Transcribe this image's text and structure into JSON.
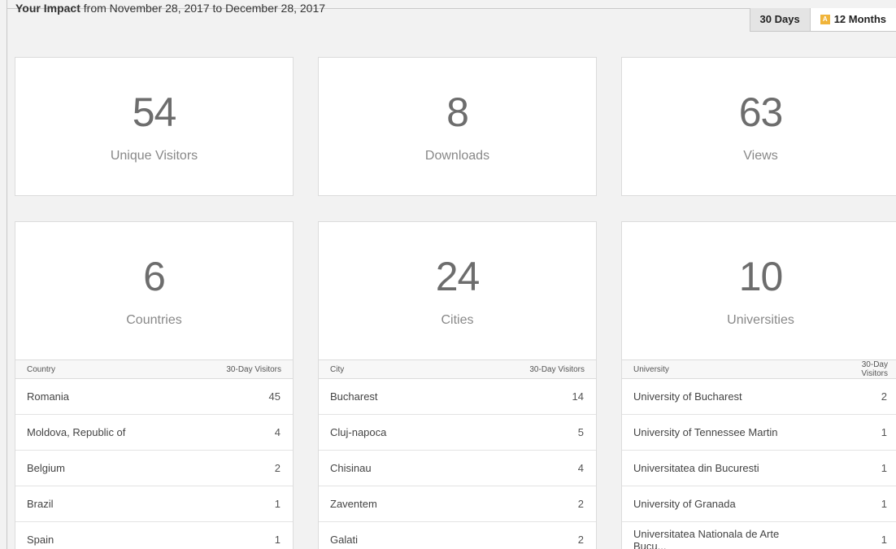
{
  "header": {
    "title_strong": "Your Impact",
    "title_rest": " from November 28, 2017 to December 28, 2017"
  },
  "toggle": {
    "days_label": "30 Days",
    "months_label": "12 Months",
    "months_icon_letter": "A"
  },
  "summary": [
    {
      "value": "54",
      "label": "Unique Visitors"
    },
    {
      "value": "8",
      "label": "Downloads"
    },
    {
      "value": "63",
      "label": "Views"
    }
  ],
  "breakdown": [
    {
      "value": "6",
      "label": "Countries",
      "col_name": "Country",
      "col_value": "30-Day Visitors",
      "rows": [
        {
          "name": "Romania",
          "count": "45"
        },
        {
          "name": "Moldova, Republic of",
          "count": "4"
        },
        {
          "name": "Belgium",
          "count": "2"
        },
        {
          "name": "Brazil",
          "count": "1"
        },
        {
          "name": "Spain",
          "count": "1"
        }
      ]
    },
    {
      "value": "24",
      "label": "Cities",
      "col_name": "City",
      "col_value": "30-Day Visitors",
      "rows": [
        {
          "name": "Bucharest",
          "count": "14"
        },
        {
          "name": "Cluj-napoca",
          "count": "5"
        },
        {
          "name": "Chisinau",
          "count": "4"
        },
        {
          "name": "Zaventem",
          "count": "2"
        },
        {
          "name": "Galati",
          "count": "2"
        }
      ]
    },
    {
      "value": "10",
      "label": "Universities",
      "col_name": "University",
      "col_value": "30-Day Visitors",
      "rows": [
        {
          "name": "University of Bucharest",
          "count": "2"
        },
        {
          "name": "University of Tennessee Martin",
          "count": "1"
        },
        {
          "name": "Universitatea din Bucuresti",
          "count": "1"
        },
        {
          "name": "University of Granada",
          "count": "1"
        },
        {
          "name": "Universitatea Nationala de Arte Bucu...",
          "count": "1"
        }
      ]
    }
  ],
  "colors": {
    "accent_badge": "#f0b43a",
    "card_bg": "#ffffff",
    "page_bg": "#f2f2f2"
  }
}
